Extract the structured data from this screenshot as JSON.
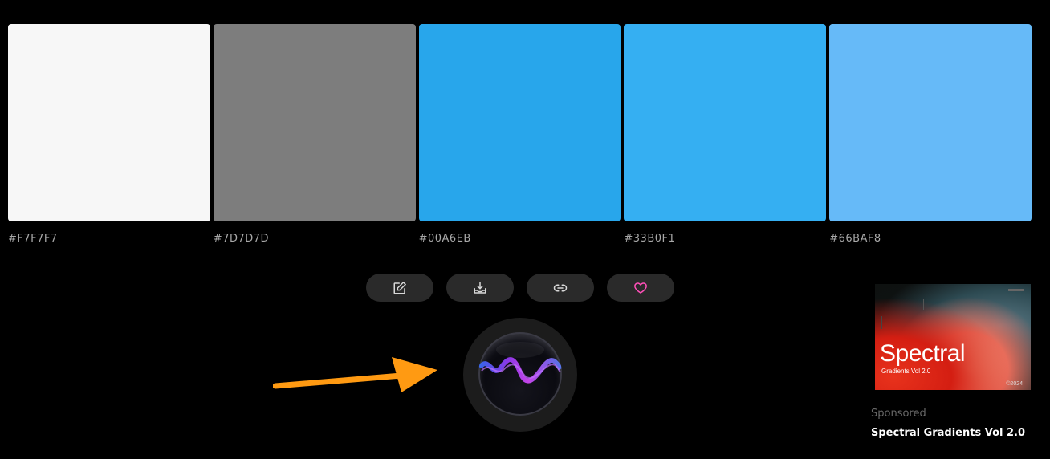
{
  "palette": {
    "swatches": [
      {
        "hex": "#F7F7F7",
        "color": "#F7F7F7"
      },
      {
        "hex": "#7D7D7D",
        "color": "#7D7D7D"
      },
      {
        "hex": "#00A6EB",
        "color": "#28A6EB"
      },
      {
        "hex": "#33B0F1",
        "color": "#35AFF2"
      },
      {
        "hex": "#66BAF8",
        "color": "#66BAF8"
      }
    ]
  },
  "actions": [
    {
      "name": "edit-icon"
    },
    {
      "name": "download-icon"
    },
    {
      "name": "link-icon"
    },
    {
      "name": "heart-icon",
      "accent": "#FF4FB8"
    }
  ],
  "annotation": {
    "arrow_color": "#FF9A12"
  },
  "ad": {
    "image_title": "Spectral",
    "image_subtitle": "Gradients Vol 2.0",
    "image_year": "©2024",
    "label": "Sponsored",
    "name": "Spectral Gradients Vol 2.0"
  }
}
